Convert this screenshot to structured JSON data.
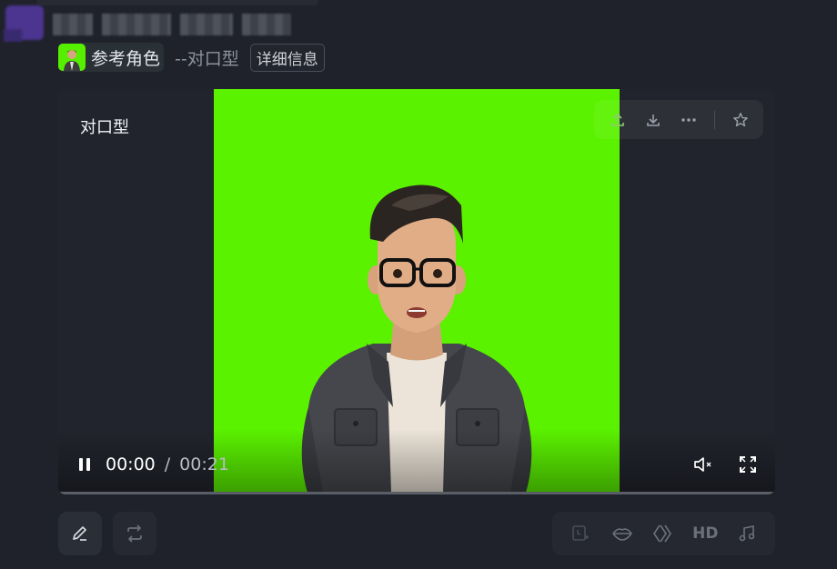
{
  "role": {
    "chip_label": "参考角色",
    "suffix": "--对口型",
    "details_button": "详细信息"
  },
  "video": {
    "title": "对口型",
    "time_current": "00:00",
    "time_separator": "/",
    "time_total": "00:21",
    "progress": 0.0,
    "background_color": "#5bf200",
    "toolbar_icons": [
      "upload-icon",
      "download-icon",
      "more-icon",
      "star-icon"
    ],
    "control_icons": [
      "pause-icon",
      "mute-icon",
      "fullscreen-icon"
    ]
  },
  "bottom_actions": {
    "left": [
      "edit-icon",
      "regenerate-icon"
    ],
    "right_tools": [
      "extend-icon",
      "lips-icon",
      "diamond-icon",
      "hd-label",
      "music-icon"
    ],
    "hd_label": "HD"
  },
  "colors": {
    "page_background": "#1f222a",
    "card_background": "#21242c",
    "accent_green": "#5bf200"
  }
}
